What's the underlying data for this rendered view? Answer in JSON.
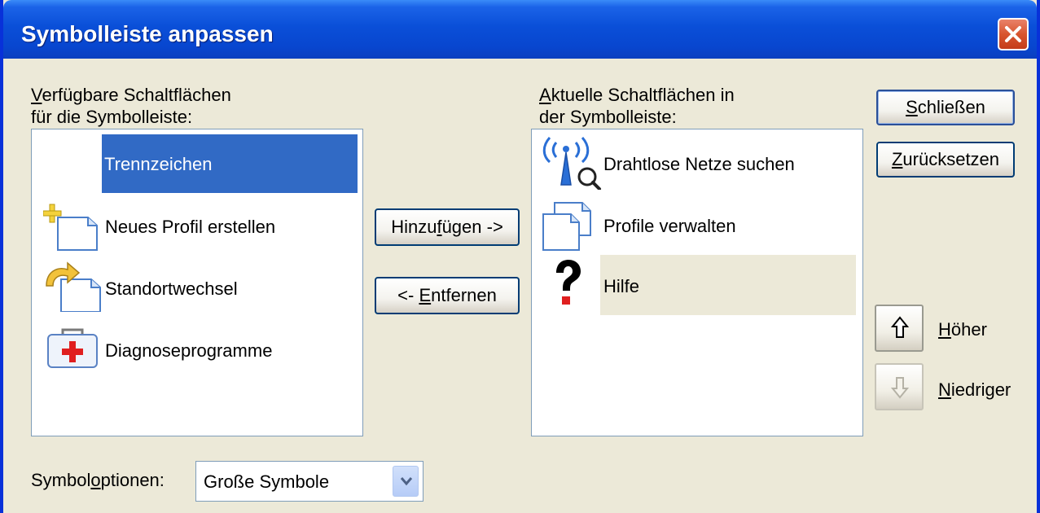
{
  "window": {
    "title": "Symbolleiste anpassen",
    "close_icon": "close-icon"
  },
  "available": {
    "label_line1_first": "V",
    "label_line1_rest": "erfügbare Schaltflächen",
    "label_line2": "für die Symbolleiste:",
    "items": [
      {
        "label": "Trennzeichen",
        "icon": "none",
        "selected": true
      },
      {
        "label": "Neues Profil erstellen",
        "icon": "new-profile-icon",
        "selected": false
      },
      {
        "label": "Standortwechsel",
        "icon": "location-change-icon",
        "selected": false
      },
      {
        "label": "Diagnoseprogramme",
        "icon": "diagnostics-icon",
        "selected": false
      }
    ]
  },
  "current": {
    "label_line1_first": "A",
    "label_line1_rest": "ktuelle Schaltflächen in",
    "label_line2": "der Symbolleiste:",
    "items": [
      {
        "label": "Drahtlose Netze suchen",
        "icon": "wireless-search-icon",
        "selected": false
      },
      {
        "label": "Profile verwalten",
        "icon": "manage-profiles-icon",
        "selected": false
      },
      {
        "label": "Hilfe",
        "icon": "help-icon",
        "selected": true
      }
    ]
  },
  "buttons": {
    "add_pre": "Hinzu",
    "add_u": "f",
    "add_post": "ügen ->",
    "remove_pre": "<- ",
    "remove_u": "E",
    "remove_post": "ntfernen",
    "close_u": "S",
    "close_post": "chließen",
    "reset_u": "Z",
    "reset_post": "urücksetzen",
    "up_u": "H",
    "up_post": "öher",
    "down_u": "N",
    "down_post": "iedriger"
  },
  "options": {
    "label_pre": "Symbol",
    "label_u": "o",
    "label_post": "ptionen:",
    "selected": "Große Symbole"
  },
  "colors": {
    "title_bar": "#0a4fd8",
    "selection": "#316ac5",
    "inactive_selection": "#ece9d8",
    "close_button": "#d8552f"
  }
}
